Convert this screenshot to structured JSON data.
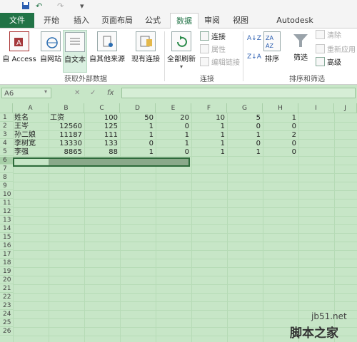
{
  "quick_access": {
    "undo": "↶",
    "redo": "↷",
    "more": "▾"
  },
  "tabs": [
    "文件",
    "开始",
    "插入",
    "页面布局",
    "公式",
    "数据",
    "审阅",
    "视图",
    "Autodesk Vault(K)"
  ],
  "ribbon": {
    "get_external": {
      "buttons": [
        "自 Access",
        "自网站",
        "自文本",
        "自其他来源",
        "现有连接"
      ],
      "group_label": "获取外部数据"
    },
    "connections": {
      "refresh_all": "全部刷新",
      "items": [
        "连接",
        "属性",
        "编辑链接"
      ],
      "group_label": "连接"
    },
    "sort_filter": {
      "sort_label": "排序",
      "filter_label": "筛选",
      "items": [
        "清除",
        "重新应用",
        "高级"
      ],
      "group_label": "排序和筛选"
    }
  },
  "formula_bar": {
    "name_box": "A6",
    "cancel": "✕",
    "enter": "✓",
    "fx": "fx",
    "value": ""
  },
  "columns": [
    "A",
    "B",
    "C",
    "D",
    "E",
    "F",
    "G",
    "H",
    "I",
    "J"
  ],
  "rows": [
    "1",
    "2",
    "3",
    "4",
    "5",
    "6",
    "7",
    "8",
    "9",
    "10",
    "11",
    "12",
    "13",
    "14",
    "15",
    "16",
    "17",
    "18",
    "19",
    "20",
    "21",
    "22",
    "23",
    "24",
    "25",
    "26"
  ],
  "cells": [
    [
      "姓名",
      "工资",
      "100",
      "50",
      "20",
      "10",
      "5",
      "1"
    ],
    [
      "王岑",
      "12560",
      "125",
      "1",
      "0",
      "1",
      "0",
      "0"
    ],
    [
      "孙二娘",
      "11187",
      "111",
      "1",
      "1",
      "1",
      "1",
      "2"
    ],
    [
      "李树宽",
      "13330",
      "133",
      "0",
      "1",
      "1",
      "0",
      "0"
    ],
    [
      "李强",
      "8865",
      "88",
      "1",
      "0",
      "1",
      "1",
      "0"
    ]
  ],
  "watermark": {
    "site": "jb51.net",
    "brand": "脚本之家"
  },
  "colors": {
    "excel_green": "#217346",
    "sheet_bg": "#c7e6c7"
  }
}
